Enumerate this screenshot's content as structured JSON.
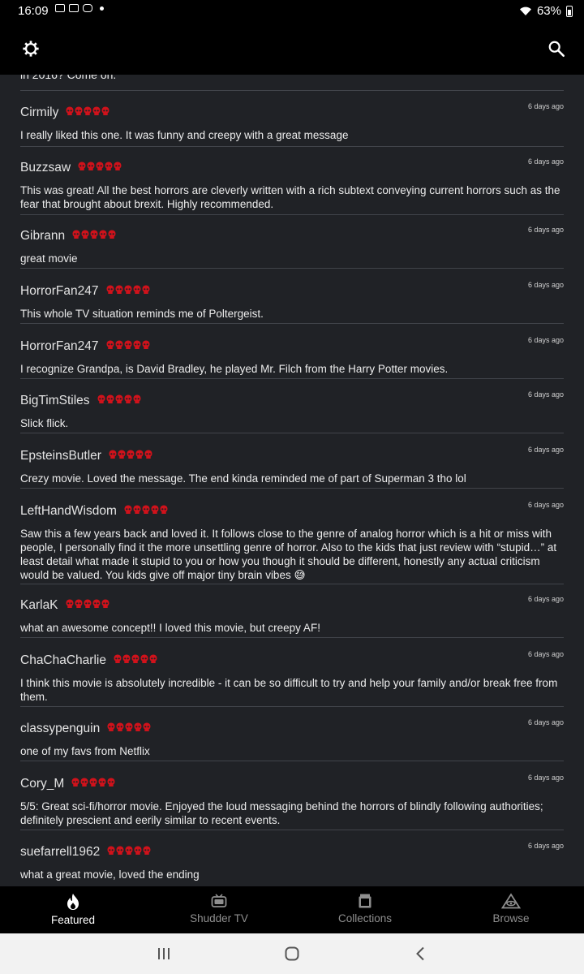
{
  "status_bar": {
    "time": "16:09",
    "battery": "63%"
  },
  "colors": {
    "skull_red": "#d0121b",
    "bg": "#202226",
    "bar": "#000000"
  },
  "top_bar": {
    "settings_icon": "gear-icon",
    "search_icon": "search-icon"
  },
  "cutoff_text": "in 2016? Come on.",
  "reviews": [
    {
      "user": "Cirmily",
      "rating": 5,
      "time": "6 days ago",
      "text": "I really liked this one. It was funny and creepy with a great message"
    },
    {
      "user": "Buzzsaw",
      "rating": 5,
      "time": "6 days ago",
      "text": "This was great! All the best horrors are cleverly written with a rich subtext conveying current horrors such as the fear that brought about brexit. Highly recommended."
    },
    {
      "user": "Gibrann",
      "rating": 5,
      "time": "6 days ago",
      "text": "great movie"
    },
    {
      "user": "HorrorFan247",
      "rating": 5,
      "time": "6 days ago",
      "text": "This whole TV situation reminds me of Poltergeist."
    },
    {
      "user": "HorrorFan247",
      "rating": 5,
      "time": "6 days ago",
      "text": "I recognize Grandpa, is David Bradley, he played Mr. Filch from the Harry Potter movies."
    },
    {
      "user": "BigTimStiles",
      "rating": 5,
      "time": "6 days ago",
      "text": "Slick flick."
    },
    {
      "user": "EpsteinsButler",
      "rating": 5,
      "time": "6 days ago",
      "text": "Crezy movie. Loved the message. The end kinda reminded me of part of Superman 3 tho lol"
    },
    {
      "user": "LeftHandWisdom",
      "rating": 5,
      "time": "6 days ago",
      "text": "Saw this a few years back and loved it. It follows close to the genre of analog horror which is a hit or miss with people, I personally find it the more unsettling genre of horror. Also to the kids that just review with “stupid…” at least detail what made it stupid to you or how you though it should be different, honestly any actual criticism would be valued. You kids give off major tiny brain vibes 😅"
    },
    {
      "user": "KarlaK",
      "rating": 5,
      "time": "6 days ago",
      "text": "what an awesome concept!! I loved this movie, but creepy AF!"
    },
    {
      "user": "ChaChaCharlie",
      "rating": 5,
      "time": "6 days ago",
      "text": "I think this movie is absolutely incredible - it can be so difficult to try and help your family and/or break free from them."
    },
    {
      "user": "classypenguin",
      "rating": 5,
      "time": "6 days ago",
      "text": "one of my favs from Netflix"
    },
    {
      "user": "Cory_M",
      "rating": 5,
      "time": "6 days ago",
      "text": "5/5: Great sci-fi/horror movie. Enjoyed the loud messaging behind the horrors of blindly following authorities; definitely prescient and eerily similar to recent events."
    },
    {
      "user": "suefarrell1962",
      "rating": 5,
      "time": "6 days ago",
      "text": "what a great movie, loved the ending"
    }
  ],
  "bottom_nav": [
    {
      "label": "Featured",
      "icon": "flame-icon",
      "active": true
    },
    {
      "label": "Shudder TV",
      "icon": "tv-icon",
      "active": false
    },
    {
      "label": "Collections",
      "icon": "collections-icon",
      "active": false
    },
    {
      "label": "Browse",
      "icon": "triangle-eye-icon",
      "active": false
    }
  ],
  "system_nav": {
    "recents": "recents-icon",
    "home": "home-icon",
    "back": "back-icon"
  }
}
